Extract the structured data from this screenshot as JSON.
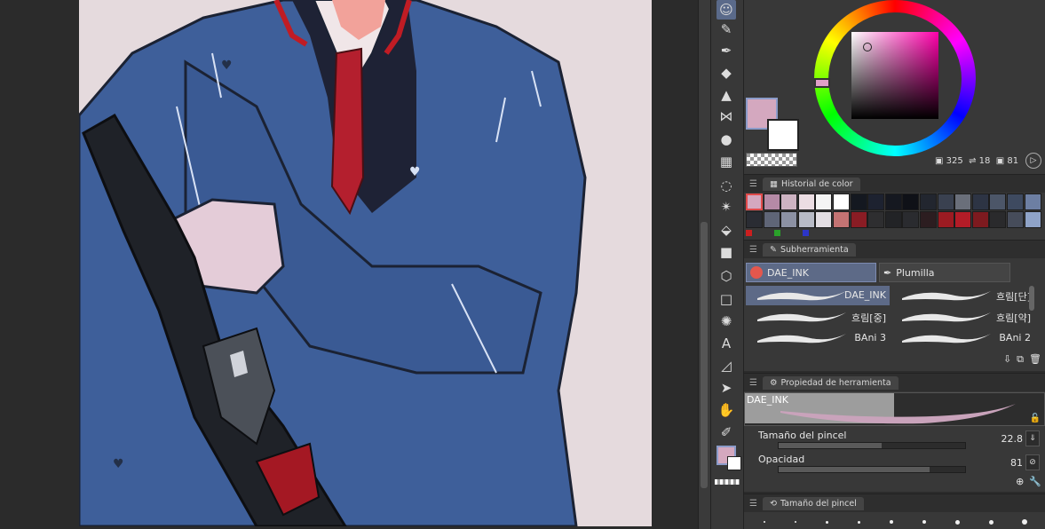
{
  "toolbar": {
    "tools": [
      "avatar-icon",
      "brush-favorites-icon",
      "pen-icon",
      "eraser-icon",
      "fill-stamp-icon",
      "bow-icon",
      "water-drop-icon",
      "grid-icon",
      "lasso-icon",
      "magic-wand-icon",
      "bucket-icon",
      "gradient-icon",
      "cube-icon",
      "rectangle-icon",
      "burst-icon",
      "text-icon",
      "ruler-icon",
      "select-arrow-icon",
      "hand-icon",
      "eyedropper-icon"
    ]
  },
  "color_wheel": {
    "main_color": "#d4a8bf",
    "sub_color": "#ffffff",
    "readout": {
      "h": "325",
      "s": "18",
      "v": "81"
    }
  },
  "color_history": {
    "title": "Historial de color",
    "row1": [
      "#d4a8bf",
      "#b58aa6",
      "#cdb3c2",
      "#ebdde3",
      "#f4f4f4",
      "#ffffff",
      "#141820",
      "#1d2230",
      "#151820",
      "#0f1117",
      "#22262f",
      "#3a4150",
      "#6a6f7a",
      "#2d3444",
      "#4c5668",
      "#3e4a60",
      "#6d7fa3"
    ],
    "row2": [
      "#2a2c33",
      "#5f6577",
      "#8c91a3",
      "#b8bbc6",
      "#e3dee3",
      "#c47373",
      "#8a1c24",
      "#2e2e30",
      "#222326",
      "#2a2b2f",
      "#2c1d20",
      "#9c1b22",
      "#b31c27",
      "#7d1a1f",
      "#2a2a2c",
      "#464c5a",
      "#8fa3c8"
    ],
    "mini_dots": [
      "#cc1f1f",
      "#2aa12a",
      "#2c35c7"
    ]
  },
  "subtool": {
    "title": "Subherramienta",
    "group_tab": "DAE_INK",
    "pen_tab": "Plumilla",
    "brushes": [
      {
        "label": "DAE_INK",
        "selected": true
      },
      {
        "label": "흐림[단]",
        "selected": false
      },
      {
        "label": "흐림[중]",
        "selected": false
      },
      {
        "label": "흐림[약]",
        "selected": false
      },
      {
        "label": "BAni 3",
        "selected": false
      },
      {
        "label": "BAni 2",
        "selected": false
      }
    ]
  },
  "tool_property": {
    "title": "Propiedad de herramienta",
    "brush_name": "DAE_INK",
    "brush_size_label": "Tamaño del pincel",
    "brush_size_value": "22.8",
    "brush_size_fraction": 0.55,
    "opacity_label": "Opacidad",
    "opacity_value": "81",
    "opacity_fraction": 0.81
  },
  "brush_size_panel": {
    "title": "Tamaño del pincel"
  }
}
